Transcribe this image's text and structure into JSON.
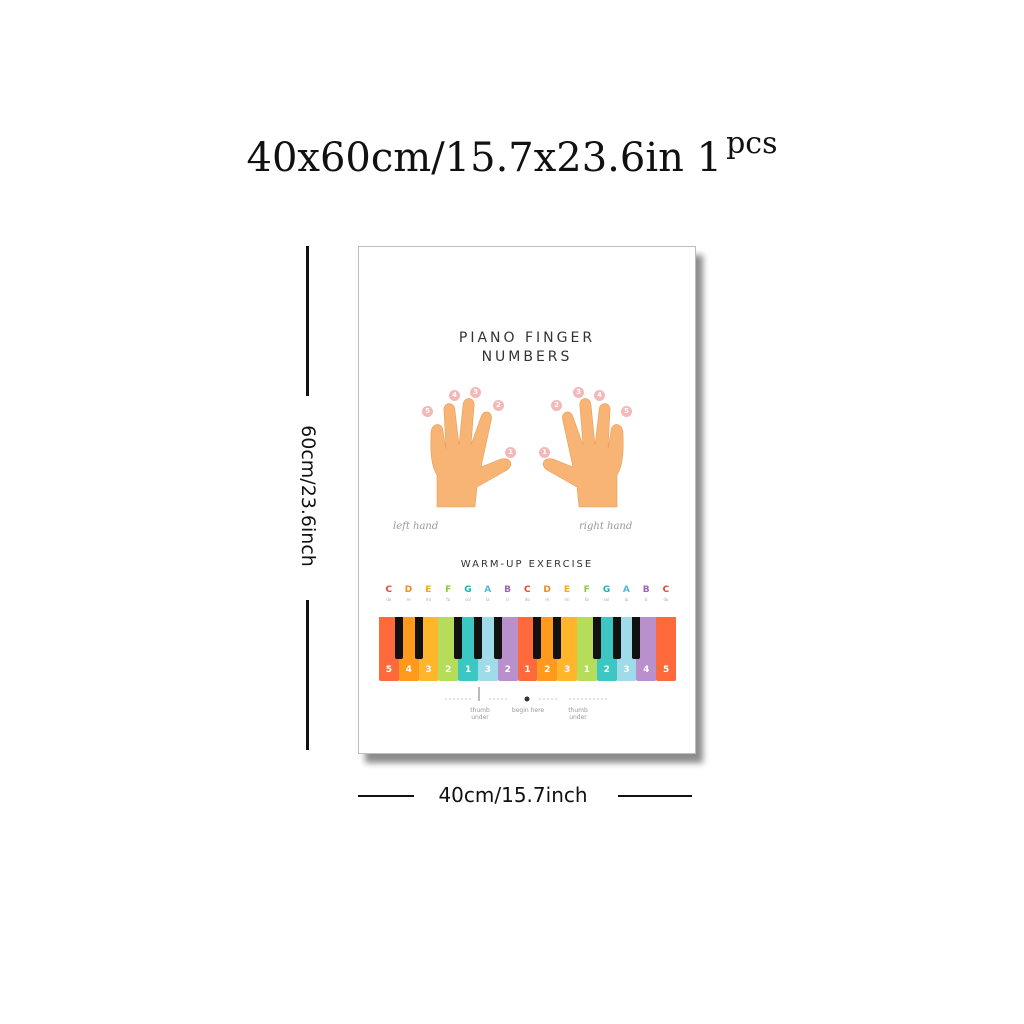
{
  "header": {
    "size_text": "40x60cm/15.7x23.6in",
    "qty_main": "1",
    "qty_sup": "pcs"
  },
  "dimensions": {
    "height_label": "60cm/23.6inch",
    "width_label": "40cm/15.7inch"
  },
  "poster": {
    "title_line1": "PIANO FINGER",
    "title_line2": "NUMBERS",
    "left_hand_label": "left hand",
    "right_hand_label": "right hand",
    "exercise_title": "WARM-UP EXERCISE",
    "left_finger_numbers": [
      "5",
      "4",
      "3",
      "2",
      "1"
    ],
    "right_finger_numbers": [
      "1",
      "2",
      "3",
      "4",
      "5"
    ],
    "legend": [
      "thumb under",
      "begin here",
      "thumb under"
    ],
    "colors": {
      "hand": "#f7b474",
      "finger_dot": "#f5b8b8",
      "text": "#333333"
    }
  },
  "keyboard": {
    "keys": [
      {
        "note": "C",
        "solfege": "do",
        "finger": "5",
        "color": "#ff6a3d"
      },
      {
        "note": "D",
        "solfege": "re",
        "finger": "4",
        "color": "#ff9a1f"
      },
      {
        "note": "E",
        "solfege": "mi",
        "finger": "3",
        "color": "#ffb62a"
      },
      {
        "note": "F",
        "solfege": "fa",
        "finger": "2",
        "color": "#b5dd5a"
      },
      {
        "note": "G",
        "solfege": "sol",
        "finger": "1",
        "color": "#3cc7c2"
      },
      {
        "note": "A",
        "solfege": "la",
        "finger": "3",
        "color": "#9fdbe8"
      },
      {
        "note": "B",
        "solfege": "ti",
        "finger": "2",
        "color": "#b98fcc"
      },
      {
        "note": "C",
        "solfege": "do",
        "finger": "1",
        "color": "#ff6a3d"
      },
      {
        "note": "D",
        "solfege": "re",
        "finger": "2",
        "color": "#ff9a1f"
      },
      {
        "note": "E",
        "solfege": "mi",
        "finger": "3",
        "color": "#ffb62a"
      },
      {
        "note": "F",
        "solfege": "fa",
        "finger": "1",
        "color": "#b5dd5a"
      },
      {
        "note": "G",
        "solfege": "sol",
        "finger": "2",
        "color": "#3cc7c2"
      },
      {
        "note": "A",
        "solfege": "la",
        "finger": "3",
        "color": "#9fdbe8"
      },
      {
        "note": "B",
        "solfege": "ti",
        "finger": "4",
        "color": "#b98fcc"
      },
      {
        "note": "C",
        "solfege": "do",
        "finger": "5",
        "color": "#ff6a3d"
      }
    ],
    "note_colors": {
      "C": "#e8432f",
      "D": "#f28a1c",
      "E": "#f5a623",
      "F": "#8dc63f",
      "G": "#19b3b0",
      "A": "#57b9d6",
      "B": "#9a64b5"
    }
  }
}
